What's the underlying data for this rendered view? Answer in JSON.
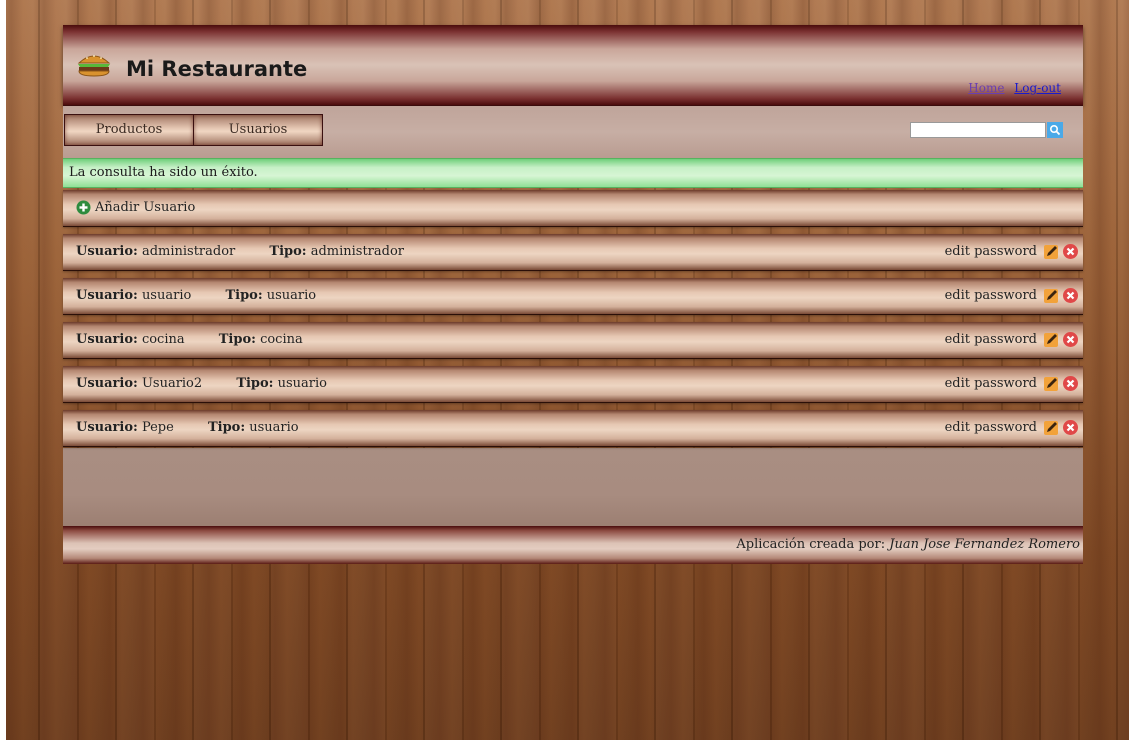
{
  "header": {
    "title": "Mi Restaurante",
    "logo_icon": "hamburger-icon",
    "links": {
      "home": "Home",
      "logout": "Log-out"
    }
  },
  "nav": {
    "tabs": [
      {
        "label": "Productos"
      },
      {
        "label": "Usuarios"
      }
    ],
    "search": {
      "value": "",
      "placeholder": "",
      "icon": "search-icon"
    }
  },
  "alert": {
    "message": "La consulta ha sido un éxito."
  },
  "add_user": {
    "label": "Añadir Usuario",
    "icon": "add-circle-icon"
  },
  "users": {
    "user_label": "Usuario:",
    "type_label": "Tipo:",
    "edit_label": "edit password",
    "rows": [
      {
        "name": "administrador",
        "type": "administrador"
      },
      {
        "name": "usuario",
        "type": "usuario"
      },
      {
        "name": "cocina",
        "type": "cocina"
      },
      {
        "name": "Usuario2",
        "type": "usuario"
      },
      {
        "name": "Pepe",
        "type": "usuario"
      }
    ]
  },
  "footer": {
    "prefix": "Aplicación creada por:",
    "author": "Juan Jose Fernandez Romero"
  },
  "colors": {
    "alert_green": "#c6f0c6",
    "delete_red": "#e04848",
    "edit_orange": "#f2a23a",
    "add_green": "#2e8b3e"
  }
}
